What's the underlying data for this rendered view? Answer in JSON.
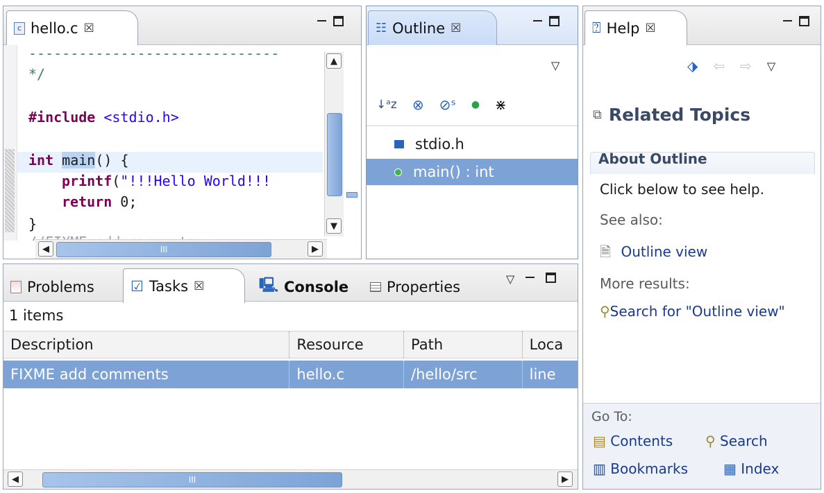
{
  "editor": {
    "tab_label": "hello.c",
    "code": {
      "dashes": "------------------------------",
      "comment_end": "*/",
      "include_kw": "#include",
      "include_file": "<stdio.h>",
      "int_kw": "int",
      "main_name": "main",
      "main_rest": "() {",
      "printf_kw": "printf",
      "printf_paren": "(",
      "printf_str": "\"!!!Hello World!!!",
      "return_kw": "return",
      "return_val": " 0;",
      "close_brace": "}",
      "partial_task": "//FIXME add comments"
    },
    "hscroll_mark": "III"
  },
  "outline": {
    "tab_label": "Outline",
    "items": [
      {
        "label": "stdio.h",
        "icon": "include-icon"
      },
      {
        "label": "main() : int",
        "icon": "function-dot-icon"
      }
    ],
    "toolbar_icons": [
      "sort-az-icon",
      "hide-fields-icon",
      "hide-static-icon",
      "hide-nonpublic-icon",
      "hide-macros-icon"
    ]
  },
  "bottom": {
    "tabs": [
      {
        "label": "Problems",
        "icon": "problems-icon"
      },
      {
        "label": "Tasks",
        "icon": "tasks-icon"
      },
      {
        "label": "Console",
        "icon": "console-icon"
      },
      {
        "label": "Properties",
        "icon": "properties-icon"
      }
    ],
    "item_count": "1 items",
    "columns": [
      "Description",
      "Resource",
      "Path",
      "Loca"
    ],
    "rows": [
      {
        "description": "FIXME add comments",
        "resource": "hello.c",
        "path": "/hello/src",
        "location": "line"
      }
    ],
    "hscroll_mark": "III"
  },
  "help": {
    "tab_label": "Help",
    "section_title": "Related Topics",
    "about_heading": "About Outline",
    "click_below": "Click below to see help.",
    "see_also": "See also:",
    "outline_view_link": "Outline view",
    "more_results": "More results:",
    "search_link": "Search for \"Outline view\"",
    "go_to": "Go To:",
    "contents_link": "Contents",
    "search_footer_link": "Search",
    "bookmarks_link": "Bookmarks",
    "index_link": "Index"
  },
  "colors": {
    "selection": "#7da3d6",
    "keyword": "#7f0055",
    "string": "#2a00ff",
    "link": "#1a3a8f"
  }
}
